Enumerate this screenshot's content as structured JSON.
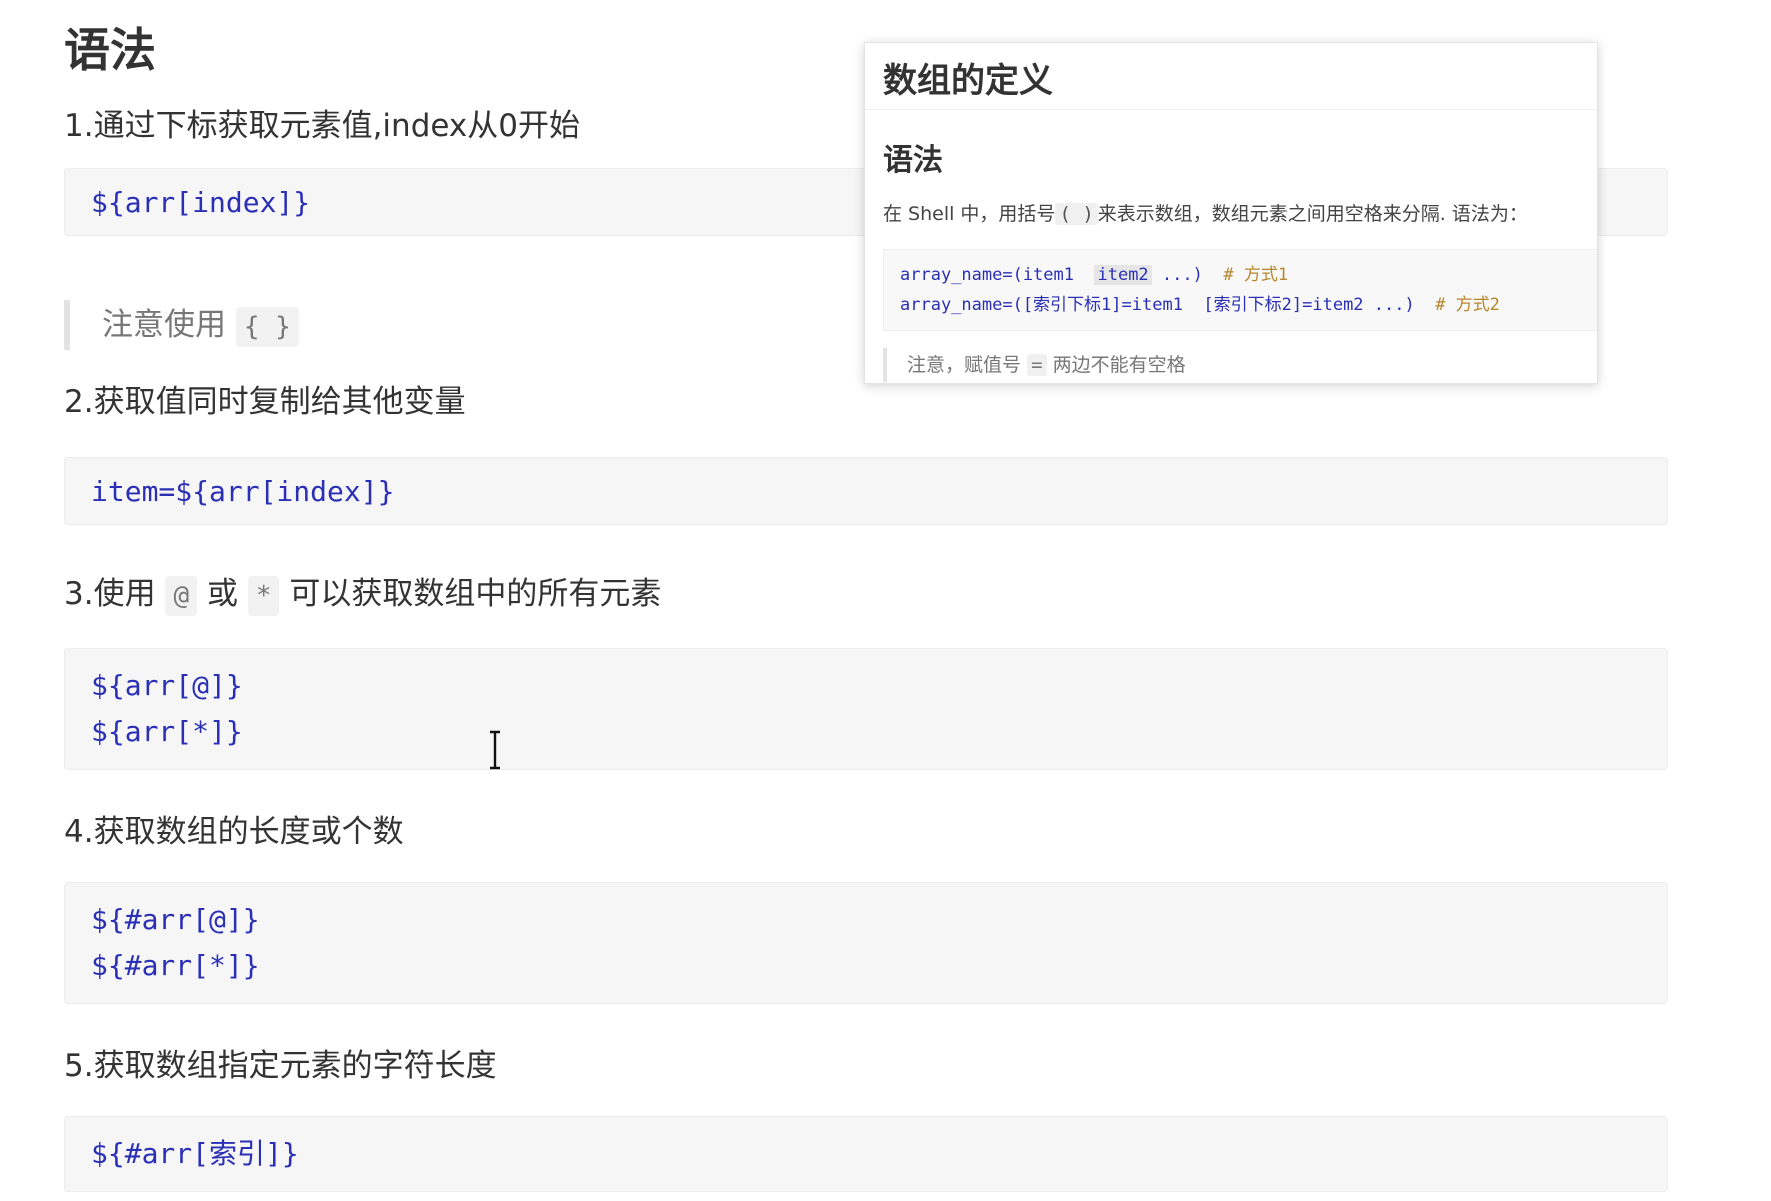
{
  "heading": "语法",
  "items": [
    {
      "text": "1.通过下标获取元素值,index从0开始",
      "code": [
        "${arr[index]}"
      ]
    },
    {
      "text": "2.获取值同时复制给其他变量",
      "code": [
        "item=${arr[index]}"
      ]
    },
    {
      "text_before": "3.使用",
      "code_a": "@",
      "text_mid": "或",
      "code_b": "*",
      "text_after": "可以获取数组中的所有元素",
      "code": [
        "${arr[@]}",
        "${arr[*]}"
      ]
    },
    {
      "text": "4.获取数组的长度或个数",
      "code": [
        "${#arr[@]}",
        "${#arr[*]}"
      ]
    },
    {
      "text": "5.获取数组指定元素的字符长度",
      "code": [
        "${#arr[索引]}"
      ]
    }
  ],
  "note": {
    "text": "注意使用",
    "code": "{ }"
  },
  "popup": {
    "title": "数组的定义",
    "subtitle": "语法",
    "desc_before": "在 Shell 中，用括号",
    "desc_code": "( )",
    "desc_after": "来表示数组，数组元素之间用空格来分隔. 语法为：",
    "code_lines": [
      {
        "code_a": "array_name=(item1",
        "code_hl": "item2",
        "code_b": "...)",
        "comment": "# 方式1"
      },
      {
        "code_a": "array_name=([索引下标1]=item1",
        "code_hl": "",
        "code_b": "[索引下标2]=item2  ...)",
        "comment": "# 方式2"
      }
    ],
    "note_before": "注意，赋值号",
    "note_code": "=",
    "note_after": "两边不能有空格"
  }
}
